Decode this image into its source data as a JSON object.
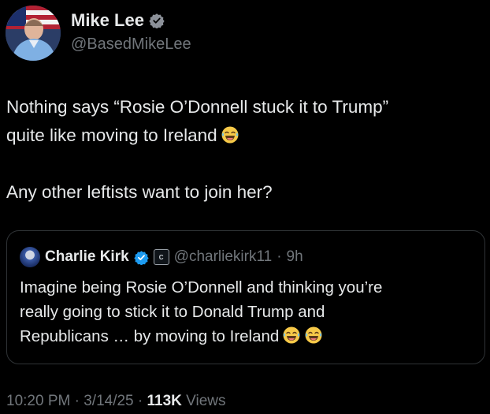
{
  "author": {
    "name": "Mike Lee",
    "handle": "@BasedMikeLee"
  },
  "post": {
    "line1": "Nothing says “Rosie O’Donnell stuck it to Trump”",
    "line2": "quite like moving to Ireland",
    "line3": "Any other leftists want to join her?",
    "emoji": "laughing-face"
  },
  "quote": {
    "author_name": "Charlie Kirk",
    "affiliate_badge_text": "C",
    "handle": "@charliekirk11",
    "separator": "·",
    "time": "9h",
    "line1": "Imagine being Rosie O’Donnell and thinking you’re",
    "line2": "really going to stick it to Donald Trump and",
    "line3": "Republicans … by moving to Ireland"
  },
  "meta": {
    "time": "10:20 PM",
    "sep1": "·",
    "date": "3/14/25",
    "sep2": "·",
    "views_count": "113K",
    "views_label": "Views"
  },
  "colors": {
    "background": "#000000",
    "text": "#e7e9ea",
    "secondary": "#71767b",
    "verified": "#1d9bf0",
    "border": "#2f3336"
  }
}
